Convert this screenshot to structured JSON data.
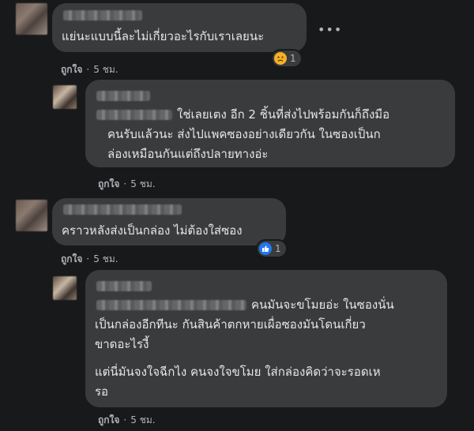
{
  "comments": [
    {
      "text_lines": [
        "แย่นะแบบนี้ละไม่เกี่ยวอะไรกับเราเลยนะ"
      ],
      "like_label": "ถูกใจ",
      "separator": "·",
      "time": "5 ชม.",
      "reaction": {
        "icon": "sad-face-icon",
        "count": "1"
      },
      "more_icon": "•••"
    },
    {
      "text_lines": [
        "ใช่เลยเตง อีก 2 ชิ้นที่ส่งไปพร้อมกันก็ถึงมือ",
        "คนรับแล้วนะ ส่งไปแพคซองอย่างเดียวกัน ในซองเป็นก",
        "ล่องเหมือนกันแต่ถึงปลายทางอ่ะ"
      ],
      "like_label": "ถูกใจ",
      "separator": "·",
      "time": "5 ชม."
    },
    {
      "text_lines": [
        "คราวหลังส่งเป็นกล่อง ไม่ต้องใส่ซอง"
      ],
      "like_label": "ถูกใจ",
      "separator": "·",
      "time": "5 ชม.",
      "reaction": {
        "icon": "thumbs-up-icon",
        "count": "1"
      }
    },
    {
      "text_lines": [
        "คนมันจะขโมยอ่ะ ในซองนั่น",
        "เป็นกล่องอีกทีนะ กันสินค้าตกหายเผื่อซองมันโดนเกี่ยว",
        "ขาดอะไรงี้",
        "แต่นี่มันจงใจฉีกไง คนจงใจขโมย ใส่กล่องคิดว่าจะรอดเห",
        "รอ"
      ],
      "like_label": "ถูกใจ",
      "separator": "·",
      "time": "5 ชม."
    }
  ],
  "colors": {
    "background": "#18191a",
    "bubble": "#3a3b3c",
    "text": "#e4e6eb",
    "meta": "#b0b3b8",
    "like_blue": "#2078f4",
    "sad_yellow": "#f7b125"
  }
}
